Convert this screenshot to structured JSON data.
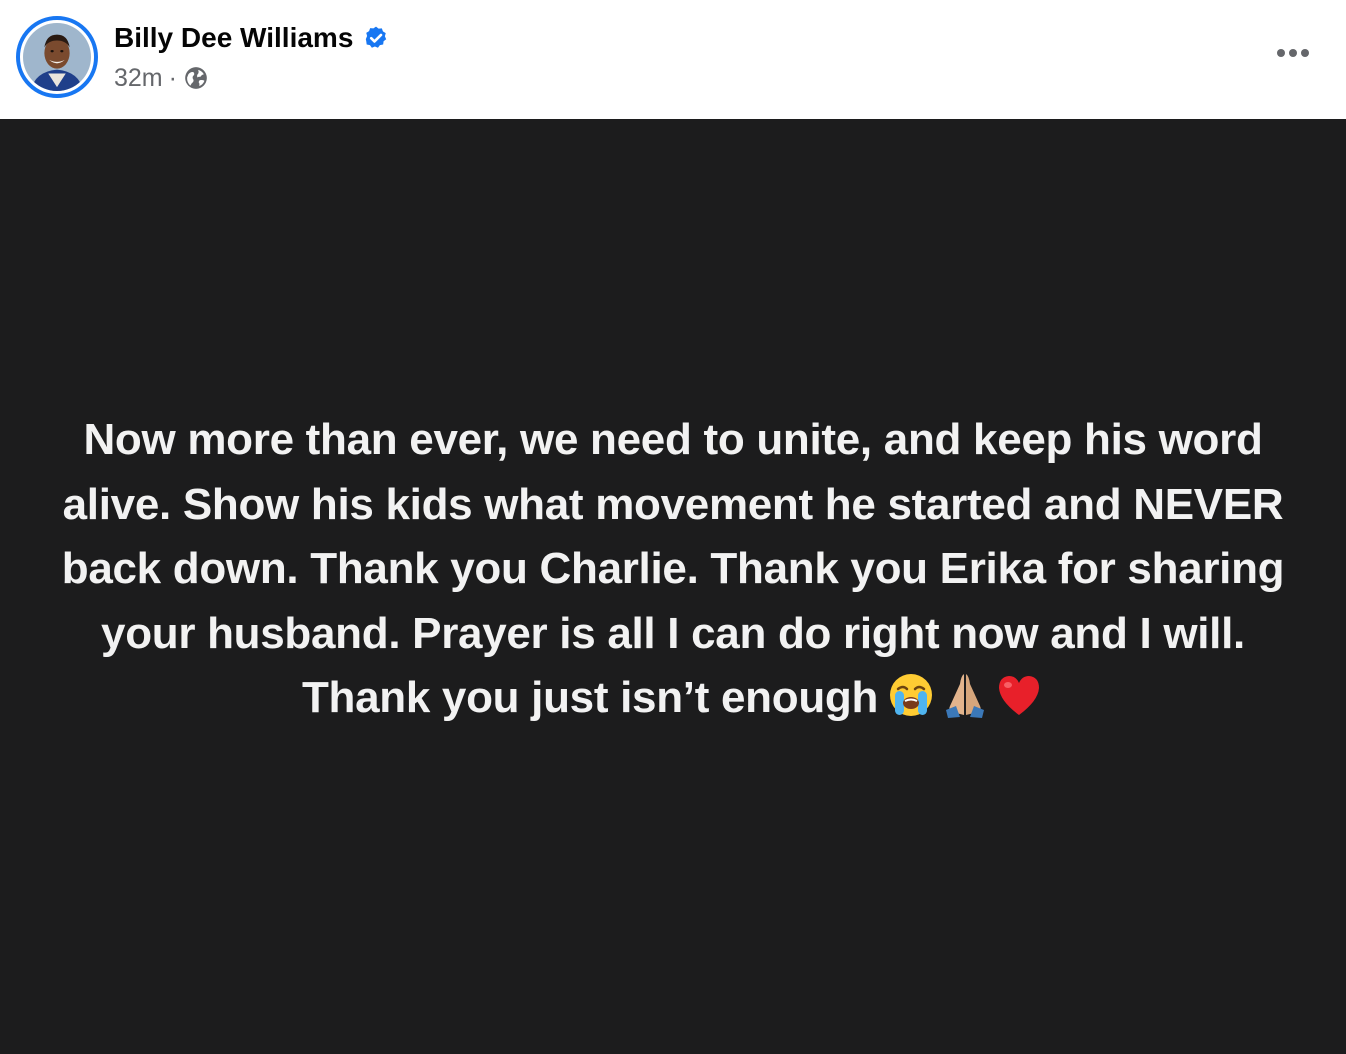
{
  "author": {
    "name": "Billy Dee Williams",
    "verified": true
  },
  "meta": {
    "timestamp": "32m",
    "separator": "·",
    "audience_icon": "globe-icon"
  },
  "menu": {
    "icon": "more-options-icon"
  },
  "post": {
    "text": "Now more than ever, we need to unite, and keep his word alive. Show his kids what movement he started and NEVER back down. Thank you Charlie. Thank you Erika for sharing your husband. Prayer is all I can do right now and I will. Thank you just isn’t enough",
    "emojis": [
      "loudly-crying-face-emoji",
      "folded-hands-emoji",
      "red-heart-emoji"
    ],
    "background_color": "#1c1c1d",
    "text_color": "#f2f2f2"
  },
  "colors": {
    "accent": "#1877f2",
    "secondary_text": "#65676b"
  }
}
